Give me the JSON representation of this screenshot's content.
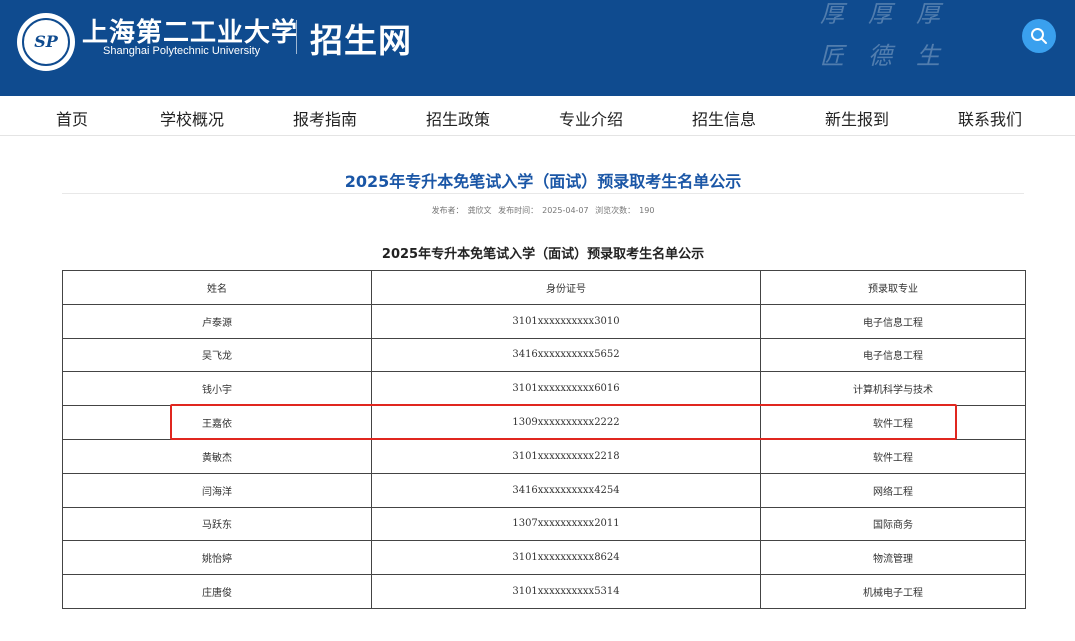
{
  "header": {
    "school_name_cn": "上海第二工业大学",
    "school_name_en": "Shanghai Polytechnic University",
    "logo_text": "SP",
    "site_name": "招生网",
    "motto": [
      "厚",
      "匠",
      "厚",
      "德",
      "厚",
      "生"
    ],
    "search_icon": "search-icon",
    "colors": {
      "header_bg": "#0f4b8f",
      "search_bg": "#3aa0ee"
    }
  },
  "nav": {
    "items": [
      {
        "label": "首页"
      },
      {
        "label": "学校概况"
      },
      {
        "label": "报考指南"
      },
      {
        "label": "招生政策"
      },
      {
        "label": "专业介绍"
      },
      {
        "label": "招生信息"
      },
      {
        "label": "新生报到"
      },
      {
        "label": "联系我们"
      }
    ]
  },
  "article": {
    "title": "2025年专升本免笔试入学（面试）预录取考生名单公示",
    "meta": {
      "publisher_label": "发布者：",
      "publisher": "龚欣文",
      "time_label": "发布时间：",
      "time": "2025-04-07",
      "views_label": "浏览次数：",
      "views": "190"
    },
    "table_heading": "2025年专升本免笔试入学（面试）预录取考生名单公示",
    "table": {
      "headers": [
        "姓名",
        "身份证号",
        "预录取专业"
      ],
      "rows": [
        {
          "name": "卢泰源",
          "id": "3101xxxxxxxxxx3010",
          "major": "电子信息工程"
        },
        {
          "name": "吴飞龙",
          "id": "3416xxxxxxxxxx5652",
          "major": "电子信息工程"
        },
        {
          "name": "钱小宇",
          "id": "3101xxxxxxxxxx6016",
          "major": "计算机科学与技术"
        },
        {
          "name": "王嘉依",
          "id": "1309xxxxxxxxxx2222",
          "major": "软件工程"
        },
        {
          "name": "黄敏杰",
          "id": "3101xxxxxxxxxx2218",
          "major": "软件工程"
        },
        {
          "name": "闫海洋",
          "id": "3416xxxxxxxxxx4254",
          "major": "网络工程"
        },
        {
          "name": "马跃东",
          "id": "1307xxxxxxxxxx2011",
          "major": "国际商务"
        },
        {
          "name": "姚怡婷",
          "id": "3101xxxxxxxxxx8624",
          "major": "物流管理"
        },
        {
          "name": "庄唐俊",
          "id": "3101xxxxxxxxxx5314",
          "major": "机械电子工程"
        }
      ]
    },
    "highlight_color": "#e0261f"
  }
}
